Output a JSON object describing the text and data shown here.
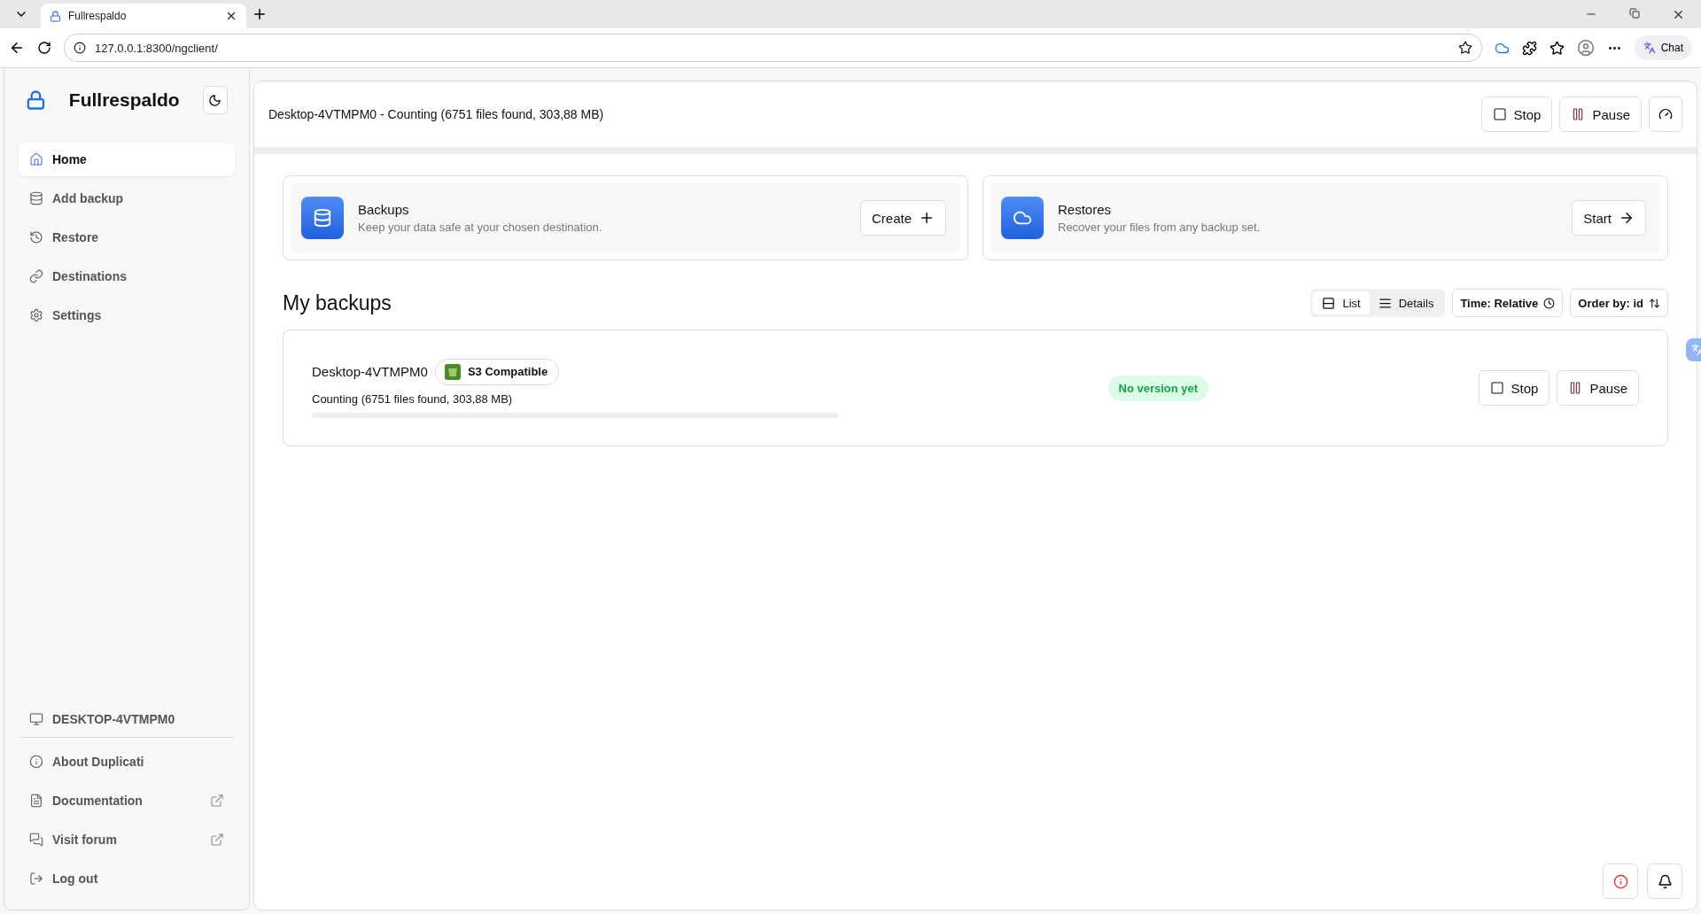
{
  "browser": {
    "tabs": [
      {
        "title": "Fullrespaldo",
        "selected": true
      }
    ],
    "address": "127.0.0.1:8300/ngclient/",
    "chat_label": "Chat"
  },
  "sidebar": {
    "brand": "Fullrespaldo",
    "items": [
      {
        "label": "Home",
        "kind": "home",
        "selected": true
      },
      {
        "label": "Add backup",
        "kind": "database",
        "selected": false
      },
      {
        "label": "Restore",
        "kind": "history",
        "selected": false
      },
      {
        "label": "Destinations",
        "kind": "link",
        "selected": false
      },
      {
        "label": "Settings",
        "kind": "settings",
        "selected": false
      }
    ],
    "machine": "DESKTOP-4VTMPM0",
    "footer_items": [
      {
        "label": "About Duplicati",
        "kind": "info",
        "external": false
      },
      {
        "label": "Documentation",
        "kind": "docs",
        "external": true
      },
      {
        "label": "Visit forum",
        "kind": "forum",
        "external": true
      },
      {
        "label": "Log out",
        "kind": "logout",
        "external": false
      }
    ]
  },
  "header": {
    "status": "Desktop-4VTMPM0 - Counting (6751 files found, 303,88 MB)",
    "buttons": [
      {
        "label": "Stop",
        "kind": "stop"
      },
      {
        "label": "Pause",
        "kind": "pause"
      }
    ]
  },
  "action_cards": [
    {
      "title": "Backups",
      "subtitle": "Keep your data safe at your chosen destination.",
      "button": "Create",
      "kind": "backup"
    },
    {
      "title": "Restores",
      "subtitle": "Recover your files from any backup set.",
      "button": "Start",
      "kind": "restore"
    }
  ],
  "backups_section": {
    "title": "My backups",
    "views": [
      {
        "label": "List",
        "kind": "list",
        "selected": true
      },
      {
        "label": "Details",
        "kind": "details",
        "selected": false
      }
    ],
    "time_filter": "Time: Relative",
    "order": "Order by: id"
  },
  "backups": [
    {
      "name": "Desktop-4VTMPM0",
      "destination": "S3 Compatible",
      "status": "Counting (6751 files found, 303,88 MB)",
      "level": 0,
      "badge": "No version yet",
      "buttons": [
        {
          "label": "Stop",
          "kind": "stop"
        },
        {
          "label": "Pause",
          "kind": "pause"
        }
      ]
    }
  ]
}
